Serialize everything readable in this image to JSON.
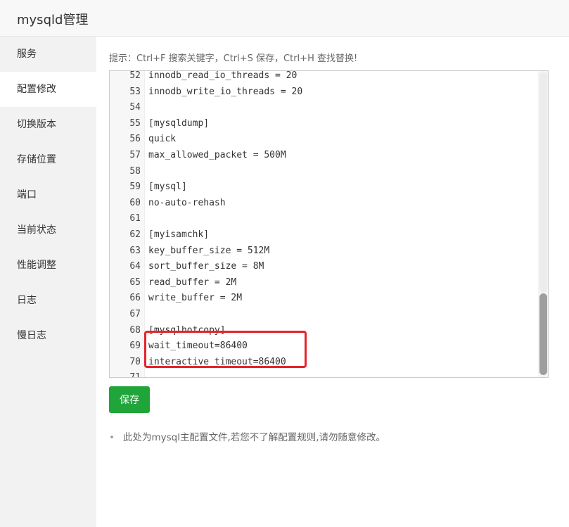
{
  "window": {
    "title": "mysqld管理"
  },
  "sidebar": {
    "items": [
      {
        "label": "服务",
        "active": false
      },
      {
        "label": "配置修改",
        "active": true
      },
      {
        "label": "切换版本",
        "active": false
      },
      {
        "label": "存储位置",
        "active": false
      },
      {
        "label": "端口",
        "active": false
      },
      {
        "label": "当前状态",
        "active": false
      },
      {
        "label": "性能调整",
        "active": false
      },
      {
        "label": "日志",
        "active": false
      },
      {
        "label": "慢日志",
        "active": false
      }
    ]
  },
  "main": {
    "tip": "提示：Ctrl+F 搜索关键字，Ctrl+S 保存，Ctrl+H 查找替换!",
    "editor": {
      "lines": [
        {
          "n": "52",
          "code": "innodb_read_io_threads = 20"
        },
        {
          "n": "53",
          "code": "innodb_write_io_threads = 20"
        },
        {
          "n": "54",
          "code": ""
        },
        {
          "n": "55",
          "code": "[mysqldump]"
        },
        {
          "n": "56",
          "code": "quick"
        },
        {
          "n": "57",
          "code": "max_allowed_packet = 500M"
        },
        {
          "n": "58",
          "code": ""
        },
        {
          "n": "59",
          "code": "[mysql]"
        },
        {
          "n": "60",
          "code": "no-auto-rehash"
        },
        {
          "n": "61",
          "code": ""
        },
        {
          "n": "62",
          "code": "[myisamchk]"
        },
        {
          "n": "63",
          "code": "key_buffer_size = 512M"
        },
        {
          "n": "64",
          "code": "sort_buffer_size = 8M"
        },
        {
          "n": "65",
          "code": "read_buffer = 2M"
        },
        {
          "n": "66",
          "code": "write_buffer = 2M"
        },
        {
          "n": "67",
          "code": ""
        },
        {
          "n": "68",
          "code": "[mysqlhotcopy]"
        },
        {
          "n": "69",
          "code": "wait_timeout=86400"
        },
        {
          "n": "70",
          "code": "interactive_timeout=86400"
        },
        {
          "n": "71",
          "code": ""
        }
      ]
    },
    "save_label": "保存",
    "note": "此处为mysql主配置文件,若您不了解配置规则,请勿随意修改。"
  },
  "colors": {
    "accent": "#20a53a",
    "highlight": "#e5242b",
    "sidebar_bg": "#f2f2f2"
  }
}
